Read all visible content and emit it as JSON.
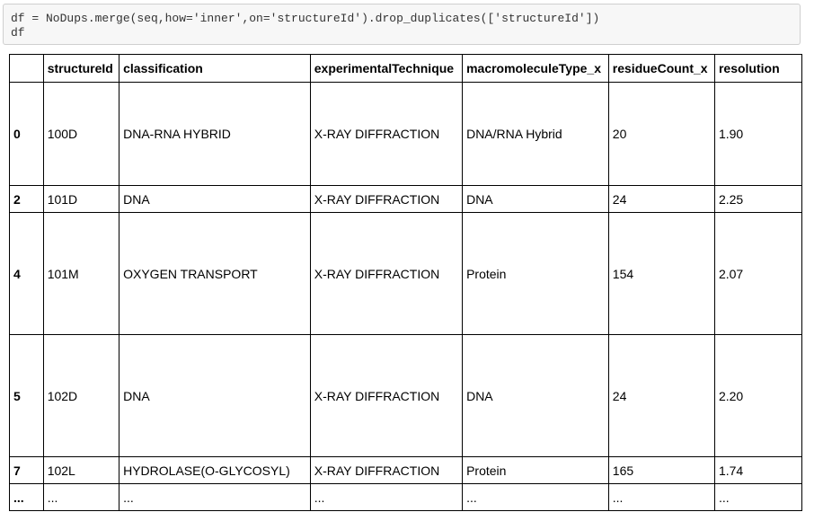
{
  "code": {
    "line1": "df = NoDups.merge(seq,how='inner',on='structureId').drop_duplicates(['structureId'])",
    "line2": "df"
  },
  "table": {
    "columns": [
      "",
      "structureId",
      "classification",
      "experimentalTechnique",
      "macromoleculeType_x",
      "residueCount_x",
      "resolution"
    ],
    "rows": [
      {
        "index": "0",
        "cells": [
          "100D",
          "DNA-RNA HYBRID",
          "X-RAY DIFFRACTION",
          "DNA/RNA Hybrid",
          "20",
          "1.90"
        ]
      },
      {
        "index": "2",
        "cells": [
          "101D",
          "DNA",
          "X-RAY DIFFRACTION",
          "DNA",
          "24",
          "2.25"
        ]
      },
      {
        "index": "4",
        "cells": [
          "101M",
          "OXYGEN TRANSPORT",
          "X-RAY DIFFRACTION",
          "Protein",
          "154",
          "2.07"
        ]
      },
      {
        "index": "5",
        "cells": [
          "102D",
          "DNA",
          "X-RAY DIFFRACTION",
          "DNA",
          "24",
          "2.20"
        ]
      },
      {
        "index": "7",
        "cells": [
          "102L",
          "HYDROLASE(O-GLYCOSYL)",
          "X-RAY DIFFRACTION",
          "Protein",
          "165",
          "1.74"
        ]
      },
      {
        "index": "...",
        "cells": [
          "...",
          "...",
          "...",
          "...",
          "...",
          "..."
        ]
      }
    ]
  }
}
